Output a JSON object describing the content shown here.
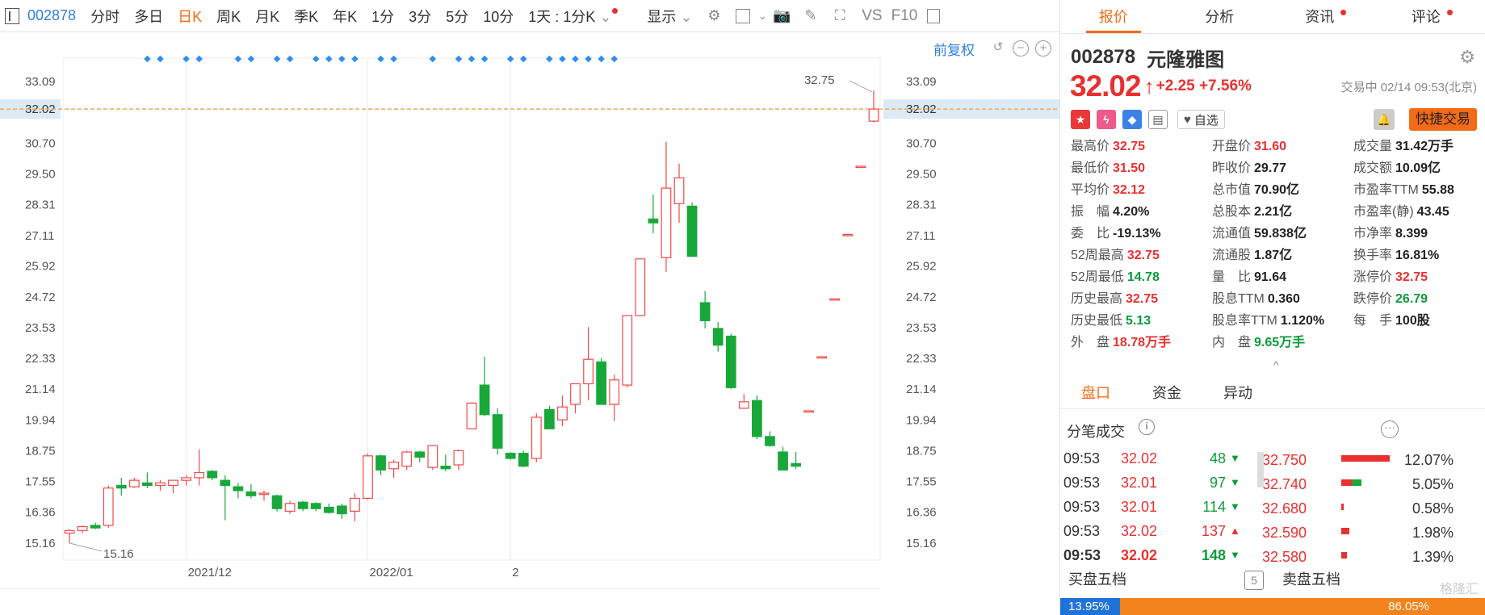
{
  "toolbar": {
    "code": "002878",
    "items": [
      "分时",
      "多日",
      "日K",
      "周K",
      "月K",
      "季K",
      "年K",
      "1分",
      "3分",
      "5分",
      "10分"
    ],
    "active": "日K",
    "interval_select": "1天 : 1分K",
    "display_label": "显示",
    "vs_label": "VS",
    "f10_label": "F10"
  },
  "chart": {
    "adjust_label": "前复权",
    "max_label": "32.75",
    "min_label": "15.16",
    "x_labels": [
      {
        "text": "2021/12",
        "index": 9
      },
      {
        "text": "2022/01",
        "index": 23
      },
      {
        "text": "2",
        "index": 34
      }
    ],
    "current_price_label": "32.02",
    "event_marker_indices": [
      6,
      7,
      9,
      10,
      13,
      14,
      16,
      17,
      19,
      20,
      21,
      22,
      24,
      25,
      28,
      30,
      31,
      32,
      34,
      35,
      37,
      38,
      39,
      40,
      41,
      42
    ]
  },
  "chart_data": {
    "type": "candlestick",
    "title": "",
    "ylim": [
      14.5,
      34.0
    ],
    "y_ticks": [
      33.09,
      32.02,
      30.7,
      29.5,
      28.31,
      27.11,
      25.92,
      24.72,
      23.53,
      22.33,
      21.14,
      19.94,
      18.75,
      17.55,
      16.36,
      15.16
    ],
    "up_color": "#f24949",
    "down_color": "#18a83a",
    "candles": [
      {
        "o": 15.55,
        "h": 15.7,
        "l": 15.16,
        "c": 15.65
      },
      {
        "o": 15.65,
        "h": 15.85,
        "l": 15.55,
        "c": 15.8
      },
      {
        "o": 15.85,
        "h": 15.95,
        "l": 15.7,
        "c": 15.75
      },
      {
        "o": 15.85,
        "h": 17.4,
        "l": 15.75,
        "c": 17.3
      },
      {
        "o": 17.4,
        "h": 17.7,
        "l": 17.0,
        "c": 17.3
      },
      {
        "o": 17.35,
        "h": 17.7,
        "l": 17.3,
        "c": 17.6
      },
      {
        "o": 17.5,
        "h": 17.9,
        "l": 17.3,
        "c": 17.4
      },
      {
        "o": 17.4,
        "h": 17.6,
        "l": 17.2,
        "c": 17.5
      },
      {
        "o": 17.4,
        "h": 17.6,
        "l": 17.1,
        "c": 17.6
      },
      {
        "o": 17.6,
        "h": 17.8,
        "l": 17.4,
        "c": 17.7
      },
      {
        "o": 17.7,
        "h": 18.8,
        "l": 17.4,
        "c": 17.9
      },
      {
        "o": 17.95,
        "h": 18.0,
        "l": 17.6,
        "c": 17.7
      },
      {
        "o": 17.6,
        "h": 17.8,
        "l": 16.05,
        "c": 17.4
      },
      {
        "o": 17.35,
        "h": 17.5,
        "l": 16.9,
        "c": 17.2
      },
      {
        "o": 17.15,
        "h": 17.45,
        "l": 16.9,
        "c": 17.0
      },
      {
        "o": 17.05,
        "h": 17.2,
        "l": 16.8,
        "c": 17.1
      },
      {
        "o": 17.0,
        "h": 17.05,
        "l": 16.4,
        "c": 16.5
      },
      {
        "o": 16.4,
        "h": 16.8,
        "l": 16.3,
        "c": 16.7
      },
      {
        "o": 16.75,
        "h": 16.8,
        "l": 16.4,
        "c": 16.5
      },
      {
        "o": 16.7,
        "h": 16.75,
        "l": 16.4,
        "c": 16.5
      },
      {
        "o": 16.55,
        "h": 16.7,
        "l": 16.3,
        "c": 16.35
      },
      {
        "o": 16.6,
        "h": 16.7,
        "l": 16.1,
        "c": 16.3
      },
      {
        "o": 16.4,
        "h": 17.1,
        "l": 16.0,
        "c": 16.9
      },
      {
        "o": 16.9,
        "h": 18.65,
        "l": 16.85,
        "c": 18.55
      },
      {
        "o": 18.55,
        "h": 18.6,
        "l": 17.8,
        "c": 18.0
      },
      {
        "o": 18.05,
        "h": 18.4,
        "l": 17.7,
        "c": 18.3
      },
      {
        "o": 18.15,
        "h": 18.75,
        "l": 18.0,
        "c": 18.7
      },
      {
        "o": 18.7,
        "h": 18.75,
        "l": 18.3,
        "c": 18.5
      },
      {
        "o": 18.1,
        "h": 18.9,
        "l": 18.0,
        "c": 18.95
      },
      {
        "o": 18.15,
        "h": 18.6,
        "l": 17.95,
        "c": 18.05
      },
      {
        "o": 18.2,
        "h": 18.8,
        "l": 18.0,
        "c": 18.75
      },
      {
        "o": 19.6,
        "h": 20.6,
        "l": 19.6,
        "c": 20.6
      },
      {
        "o": 21.3,
        "h": 22.4,
        "l": 20.1,
        "c": 20.15
      },
      {
        "o": 20.15,
        "h": 20.4,
        "l": 18.6,
        "c": 18.85
      },
      {
        "o": 18.65,
        "h": 18.7,
        "l": 18.4,
        "c": 18.45
      },
      {
        "o": 18.65,
        "h": 18.75,
        "l": 18.1,
        "c": 18.15
      },
      {
        "o": 18.45,
        "h": 20.2,
        "l": 18.3,
        "c": 20.05
      },
      {
        "o": 20.35,
        "h": 20.5,
        "l": 19.6,
        "c": 19.6
      },
      {
        "o": 19.95,
        "h": 20.9,
        "l": 19.7,
        "c": 20.45
      },
      {
        "o": 20.55,
        "h": 21.2,
        "l": 20.2,
        "c": 21.35
      },
      {
        "o": 21.35,
        "h": 23.55,
        "l": 20.7,
        "c": 22.3
      },
      {
        "o": 22.2,
        "h": 22.35,
        "l": 20.55,
        "c": 20.55
      },
      {
        "o": 20.55,
        "h": 21.7,
        "l": 19.9,
        "c": 21.5
      },
      {
        "o": 21.3,
        "h": 24.0,
        "l": 21.2,
        "c": 24.0
      },
      {
        "o": 24.0,
        "h": 26.2,
        "l": 24.0,
        "c": 26.2
      },
      {
        "o": 27.75,
        "h": 28.7,
        "l": 27.2,
        "c": 27.6
      },
      {
        "o": 26.25,
        "h": 30.75,
        "l": 25.7,
        "c": 28.95
      },
      {
        "o": 28.35,
        "h": 29.9,
        "l": 27.6,
        "c": 29.35
      },
      {
        "o": 28.25,
        "h": 28.4,
        "l": 26.3,
        "c": 26.3
      },
      {
        "o": 24.5,
        "h": 24.95,
        "l": 23.5,
        "c": 23.8
      },
      {
        "o": 23.5,
        "h": 23.75,
        "l": 22.6,
        "c": 22.85
      },
      {
        "o": 23.2,
        "h": 23.3,
        "l": 21.15,
        "c": 21.2
      },
      {
        "o": 20.4,
        "h": 20.95,
        "l": 20.4,
        "c": 20.65
      },
      {
        "o": 20.7,
        "h": 20.9,
        "l": 19.2,
        "c": 19.3
      },
      {
        "o": 19.3,
        "h": 19.5,
        "l": 18.9,
        "c": 18.95
      },
      {
        "o": 18.7,
        "h": 18.9,
        "l": 18.0,
        "c": 18.0
      },
      {
        "o": 18.25,
        "h": 18.7,
        "l": 18.05,
        "c": 18.15
      },
      {
        "o": 20.25,
        "h": 20.3,
        "l": 20.25,
        "c": 20.3
      },
      {
        "o": 22.35,
        "h": 22.4,
        "l": 22.35,
        "c": 22.4
      },
      {
        "o": 24.6,
        "h": 24.65,
        "l": 24.6,
        "c": 24.65
      },
      {
        "o": 27.1,
        "h": 27.15,
        "l": 27.1,
        "c": 27.15
      },
      {
        "o": 29.75,
        "h": 29.8,
        "l": 29.75,
        "c": 29.8
      },
      {
        "o": 31.55,
        "h": 32.75,
        "l": 31.5,
        "c": 32.02
      }
    ]
  },
  "right": {
    "tabs": [
      {
        "label": "报价",
        "dot": false
      },
      {
        "label": "分析",
        "dot": false
      },
      {
        "label": "资讯",
        "dot": true
      },
      {
        "label": "评论",
        "dot": true
      }
    ],
    "active_tab": "报价",
    "code": "002878",
    "name": "元隆雅图",
    "price": "32.02",
    "arrow": "↑",
    "change": "+2.25 +7.56%",
    "trade_time": "交易中 02/14 09:53(北京)",
    "watch_label": "自选",
    "quick_trade_label": "快捷交易",
    "stats": [
      {
        "label": "最高价",
        "value": "32.75",
        "color": "red"
      },
      {
        "label": "开盘价",
        "value": "31.60",
        "color": "red"
      },
      {
        "label": "成交量",
        "value": "31.42万手",
        "color": "dark"
      },
      {
        "label": "最低价",
        "value": "31.50",
        "color": "red"
      },
      {
        "label": "昨收价",
        "value": "29.77",
        "color": "dark"
      },
      {
        "label": "成交额",
        "value": "10.09亿",
        "color": "dark"
      },
      {
        "label": "平均价",
        "value": "32.12",
        "color": "red"
      },
      {
        "label": "总市值",
        "value": "70.90亿",
        "color": "dark"
      },
      {
        "label": "市盈率TTM",
        "value": "55.88",
        "color": "dark"
      },
      {
        "label": "振　幅",
        "value": "4.20%",
        "color": "dark"
      },
      {
        "label": "总股本",
        "value": "2.21亿",
        "color": "dark"
      },
      {
        "label": "市盈率(静)",
        "value": "43.45",
        "color": "dark"
      },
      {
        "label": "委　比",
        "value": "-19.13%",
        "color": "dark"
      },
      {
        "label": "流通值",
        "value": "59.838亿",
        "color": "dark"
      },
      {
        "label": "市净率",
        "value": "8.399",
        "color": "dark"
      },
      {
        "label": "52周最高",
        "value": "32.75",
        "color": "red"
      },
      {
        "label": "流通股",
        "value": "1.87亿",
        "color": "dark"
      },
      {
        "label": "换手率",
        "value": "16.81%",
        "color": "dark"
      },
      {
        "label": "52周最低",
        "value": "14.78",
        "color": "green"
      },
      {
        "label": "量　比",
        "value": "91.64",
        "color": "dark"
      },
      {
        "label": "涨停价",
        "value": "32.75",
        "color": "red"
      },
      {
        "label": "历史最高",
        "value": "32.75",
        "color": "red"
      },
      {
        "label": "股息TTM",
        "value": "0.360",
        "color": "dark"
      },
      {
        "label": "跌停价",
        "value": "26.79",
        "color": "green"
      },
      {
        "label": "历史最低",
        "value": "5.13",
        "color": "green"
      },
      {
        "label": "股息率TTM",
        "value": "1.120%",
        "color": "dark"
      },
      {
        "label": "每　手",
        "value": "100股",
        "color": "dark"
      },
      {
        "label": "外　盘",
        "value": "18.78万手",
        "color": "red"
      },
      {
        "label": "内　盘",
        "value": "9.65万手",
        "color": "green"
      }
    ],
    "sub_tabs": [
      "盘口",
      "资金",
      "异动"
    ],
    "active_sub_tab": "盘口",
    "tick_title": "分笔成交",
    "trades": [
      {
        "time": "09:53",
        "price": "32.02",
        "vol": "48",
        "dir": "down"
      },
      {
        "time": "09:53",
        "price": "32.01",
        "vol": "97",
        "dir": "down"
      },
      {
        "time": "09:53",
        "price": "32.01",
        "vol": "114",
        "dir": "down"
      },
      {
        "time": "09:53",
        "price": "32.02",
        "vol": "137",
        "dir": "up"
      },
      {
        "time": "09:53",
        "price": "32.02",
        "vol": "148",
        "dir": "down"
      }
    ],
    "depth": [
      {
        "price": "32.750",
        "pct": "12.07%",
        "pct_num": 12.07
      },
      {
        "price": "32.740",
        "pct": "5.05%",
        "pct_num": 5.05
      },
      {
        "price": "32.680",
        "pct": "0.58%",
        "pct_num": 0.58
      },
      {
        "price": "32.590",
        "pct": "1.98%",
        "pct_num": 1.98
      },
      {
        "price": "32.580",
        "pct": "1.39%",
        "pct_num": 1.39
      }
    ],
    "buy_label": "买盘五档",
    "sell_label": "卖盘五档",
    "buy_pct": "13.95%",
    "sell_pct": "86.05%",
    "buy_ratio": 13.95,
    "watermark": "格隆汇"
  }
}
